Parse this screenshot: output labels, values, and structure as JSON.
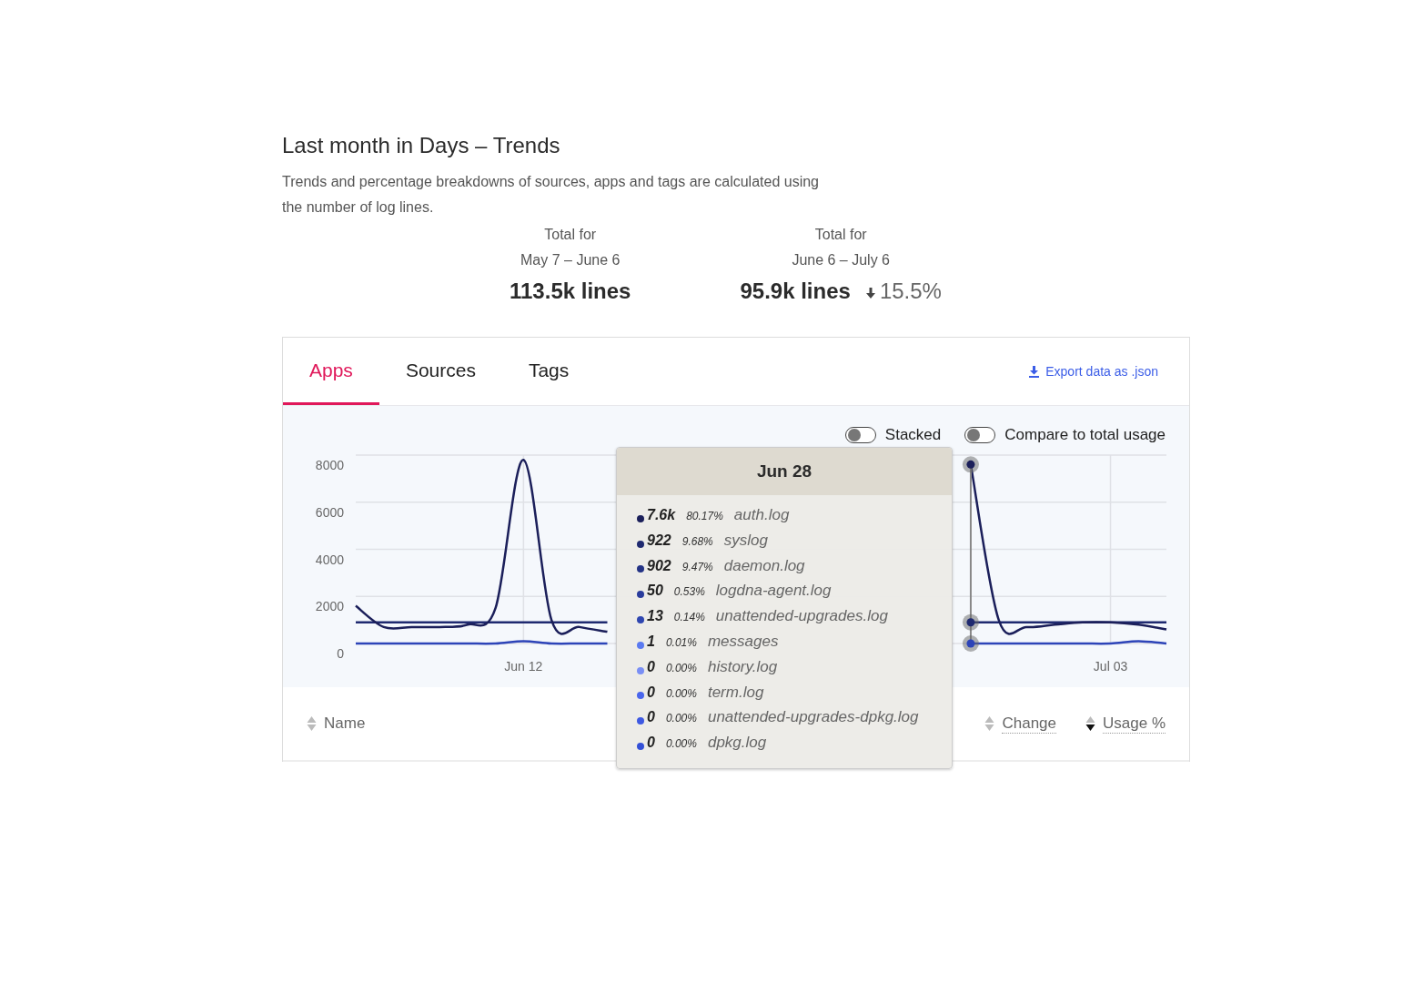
{
  "header": {
    "title": "Last month in Days – Trends",
    "description": "Trends and percentage breakdowns of sources, apps and tags are calculated using the number of log lines."
  },
  "totals": [
    {
      "label": "Total for",
      "range": "May 7 – June 6",
      "value": "113.5k lines"
    },
    {
      "label": "Total for",
      "range": "June 6 – July 6",
      "value": "95.9k lines",
      "change": {
        "decrease": true,
        "text": "15.5%"
      }
    }
  ],
  "tabs": [
    {
      "label": "Apps",
      "selected": true
    },
    {
      "label": "Sources",
      "selected": false
    },
    {
      "label": "Tags",
      "selected": false
    }
  ],
  "export_link": "Export data as .json",
  "toggles": [
    {
      "label": "Stacked",
      "on": false
    },
    {
      "label": "Compare to total usage",
      "on": false
    }
  ],
  "chart": {
    "chart_data": {
      "type": "line",
      "categories": [
        null,
        null,
        null,
        null,
        null,
        null,
        "Jun 12",
        null,
        null,
        null,
        null,
        null,
        null,
        null,
        null,
        null,
        null,
        null,
        null,
        null,
        null,
        null,
        null,
        null,
        null,
        null,
        null,
        "Jul 03",
        null,
        null
      ],
      "ylim": [
        0,
        8000
      ],
      "yticks": [
        0,
        2000,
        4000,
        6000,
        8000
      ],
      "grid": true,
      "series": [
        {
          "color": "#1b1f5a",
          "values": [
            1600,
            700,
            700,
            700,
            800,
            1500,
            7800,
            1000,
            700,
            500,
            null,
            null,
            null,
            null,
            null,
            null,
            null,
            null,
            null,
            null,
            null,
            null,
            7600,
            1000,
            700,
            800,
            900,
            900,
            800,
            600
          ]
        },
        {
          "color": "#1f2a70",
          "values": [
            900,
            900,
            900,
            900,
            900,
            900,
            900,
            900,
            900,
            900,
            null,
            null,
            null,
            null,
            null,
            null,
            null,
            null,
            null,
            null,
            null,
            null,
            900,
            900,
            900,
            900,
            900,
            900,
            900,
            900
          ]
        },
        {
          "color": "#2d44b8",
          "values": [
            0,
            0,
            0,
            0,
            0,
            0,
            100,
            0,
            0,
            0,
            null,
            null,
            null,
            null,
            null,
            null,
            null,
            null,
            null,
            null,
            null,
            null,
            0,
            0,
            0,
            0,
            0,
            0,
            100,
            0
          ]
        }
      ]
    }
  },
  "tooltip": {
    "title": "Jun 28",
    "items": [
      {
        "value": "7.6k",
        "percent": "80.17%",
        "name": "auth.log",
        "color": "#1b1f5a"
      },
      {
        "value": "922",
        "percent": "9.68%",
        "name": "syslog",
        "color": "#1f2a70"
      },
      {
        "value": "902",
        "percent": "9.47%",
        "name": "daemon.log",
        "color": "#243385"
      },
      {
        "value": "50",
        "percent": "0.53%",
        "name": "logdna-agent.log",
        "color": "#2a3c9c"
      },
      {
        "value": "13",
        "percent": "0.14%",
        "name": "unattended-upgrades.log",
        "color": "#2f46b0"
      },
      {
        "value": "1",
        "percent": "0.01%",
        "name": "messages",
        "color": "#5b7af0"
      },
      {
        "value": "0",
        "percent": "0.00%",
        "name": "history.log",
        "color": "#7a8ff5"
      },
      {
        "value": "0",
        "percent": "0.00%",
        "name": "term.log",
        "color": "#4a66ec"
      },
      {
        "value": "0",
        "percent": "0.00%",
        "name": "unattended-upgrades-dpkg.log",
        "color": "#3e59e2"
      },
      {
        "value": "0",
        "percent": "0.00%",
        "name": "dpkg.log",
        "color": "#3450d6"
      }
    ]
  },
  "table": {
    "columns": [
      {
        "label": "Name",
        "sorted": false,
        "underlined": false
      },
      {
        "label": "Change",
        "sorted": false,
        "underlined": true
      },
      {
        "label": "Usage %",
        "sorted": true,
        "underlined": true
      }
    ]
  }
}
